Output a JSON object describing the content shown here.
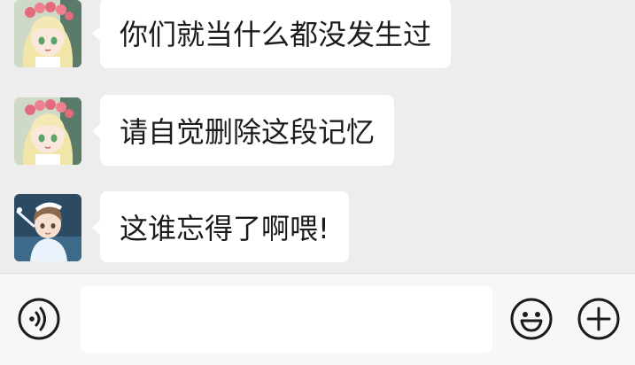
{
  "messages": [
    {
      "avatar": "princess-avatar",
      "text": "你们就当什么都没发生过"
    },
    {
      "avatar": "princess-avatar",
      "text": "请自觉删除这段记忆"
    },
    {
      "avatar": "boy-avatar",
      "text": "这谁忘得了啊喂!"
    }
  ],
  "input_bar": {
    "voice_icon": "voice-icon",
    "text_value": "",
    "emoji_icon": "emoji-icon",
    "plus_icon": "plus-icon"
  },
  "colors": {
    "background": "#ededed",
    "bubble": "#ffffff",
    "text": "#1b1b1b",
    "input_bar": "#f7f7f7"
  }
}
